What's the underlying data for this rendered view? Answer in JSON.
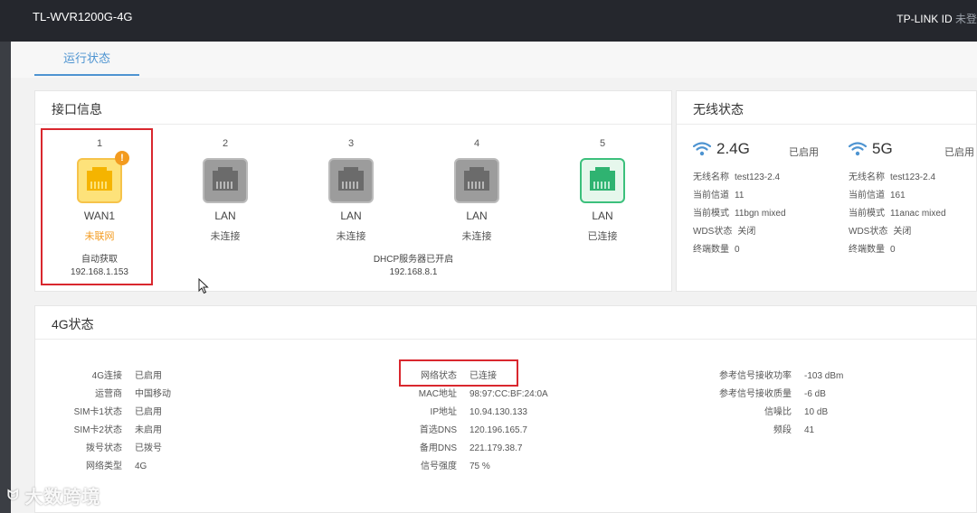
{
  "header": {
    "model": "TL-WVR1200G-4G",
    "account_label": "TP-LINK ID",
    "account_status": "未登"
  },
  "tabs": [
    {
      "label": "运行状态",
      "active": true
    }
  ],
  "interfaces": {
    "title": "接口信息",
    "ports": [
      {
        "number": "1",
        "name": "WAN1",
        "status": "未联网",
        "icon": "ethernet-port-warning-icon",
        "alert": "!"
      },
      {
        "number": "2",
        "name": "LAN",
        "status": "未连接",
        "icon": "ethernet-port-icon"
      },
      {
        "number": "3",
        "name": "LAN",
        "status": "未连接",
        "icon": "ethernet-port-icon"
      },
      {
        "number": "4",
        "name": "LAN",
        "status": "未连接",
        "icon": "ethernet-port-icon"
      },
      {
        "number": "5",
        "name": "LAN",
        "status": "已连接",
        "icon": "ethernet-port-connected-icon"
      }
    ],
    "wan_mode": "自动获取",
    "wan_ip": "192.168.1.153",
    "dhcp_status": "DHCP服务器已开启",
    "lan_ip": "192.168.8.1"
  },
  "wireless": {
    "title": "无线状态",
    "bands": [
      {
        "band": "2.4G",
        "state": "已启用",
        "rows": [
          {
            "label": "无线名称",
            "value": "test123-2.4"
          },
          {
            "label": "当前信道",
            "value": "11"
          },
          {
            "label": "当前模式",
            "value": "11bgn mixed"
          },
          {
            "label": "WDS状态",
            "value": "关闭"
          },
          {
            "label": "终端数量",
            "value": "0"
          }
        ]
      },
      {
        "band": "5G",
        "state": "已启用",
        "rows": [
          {
            "label": "无线名称",
            "value": "test123-2.4"
          },
          {
            "label": "当前信道",
            "value": "161"
          },
          {
            "label": "当前模式",
            "value": "11anac mixed"
          },
          {
            "label": "WDS状态",
            "value": "关闭"
          },
          {
            "label": "终端数量",
            "value": "0"
          }
        ]
      }
    ]
  },
  "lte": {
    "title": "4G状态",
    "col1": [
      {
        "label": "4G连接",
        "value": "已启用"
      },
      {
        "label": "运营商",
        "value": "中国移动"
      },
      {
        "label": "SIM卡1状态",
        "value": "已启用"
      },
      {
        "label": "SIM卡2状态",
        "value": "未启用"
      },
      {
        "label": "拨号状态",
        "value": "已拨号"
      },
      {
        "label": "网络类型",
        "value": "4G"
      }
    ],
    "col2": [
      {
        "label": "网络状态",
        "value": "已连接"
      },
      {
        "label": "MAC地址",
        "value": "98:97:CC:BF:24:0A"
      },
      {
        "label": "IP地址",
        "value": "10.94.130.133"
      },
      {
        "label": "首选DNS",
        "value": "120.196.165.7"
      },
      {
        "label": "备用DNS",
        "value": "221.179.38.7"
      },
      {
        "label": "信号强度",
        "value": "75 %"
      }
    ],
    "col3": [
      {
        "label": "参考信号接收功率",
        "value": "-103 dBm"
      },
      {
        "label": "参考信号接收质量",
        "value": "-6 dB"
      },
      {
        "label": "信噪比",
        "value": "10 dB"
      },
      {
        "label": "频段",
        "value": "41"
      }
    ]
  },
  "watermark": {
    "text": "大数跨境"
  },
  "colors": {
    "accent": "#4e94d1",
    "warning": "#f39b1f",
    "connected": "#3cc07c",
    "highlight": "#d9272e"
  }
}
